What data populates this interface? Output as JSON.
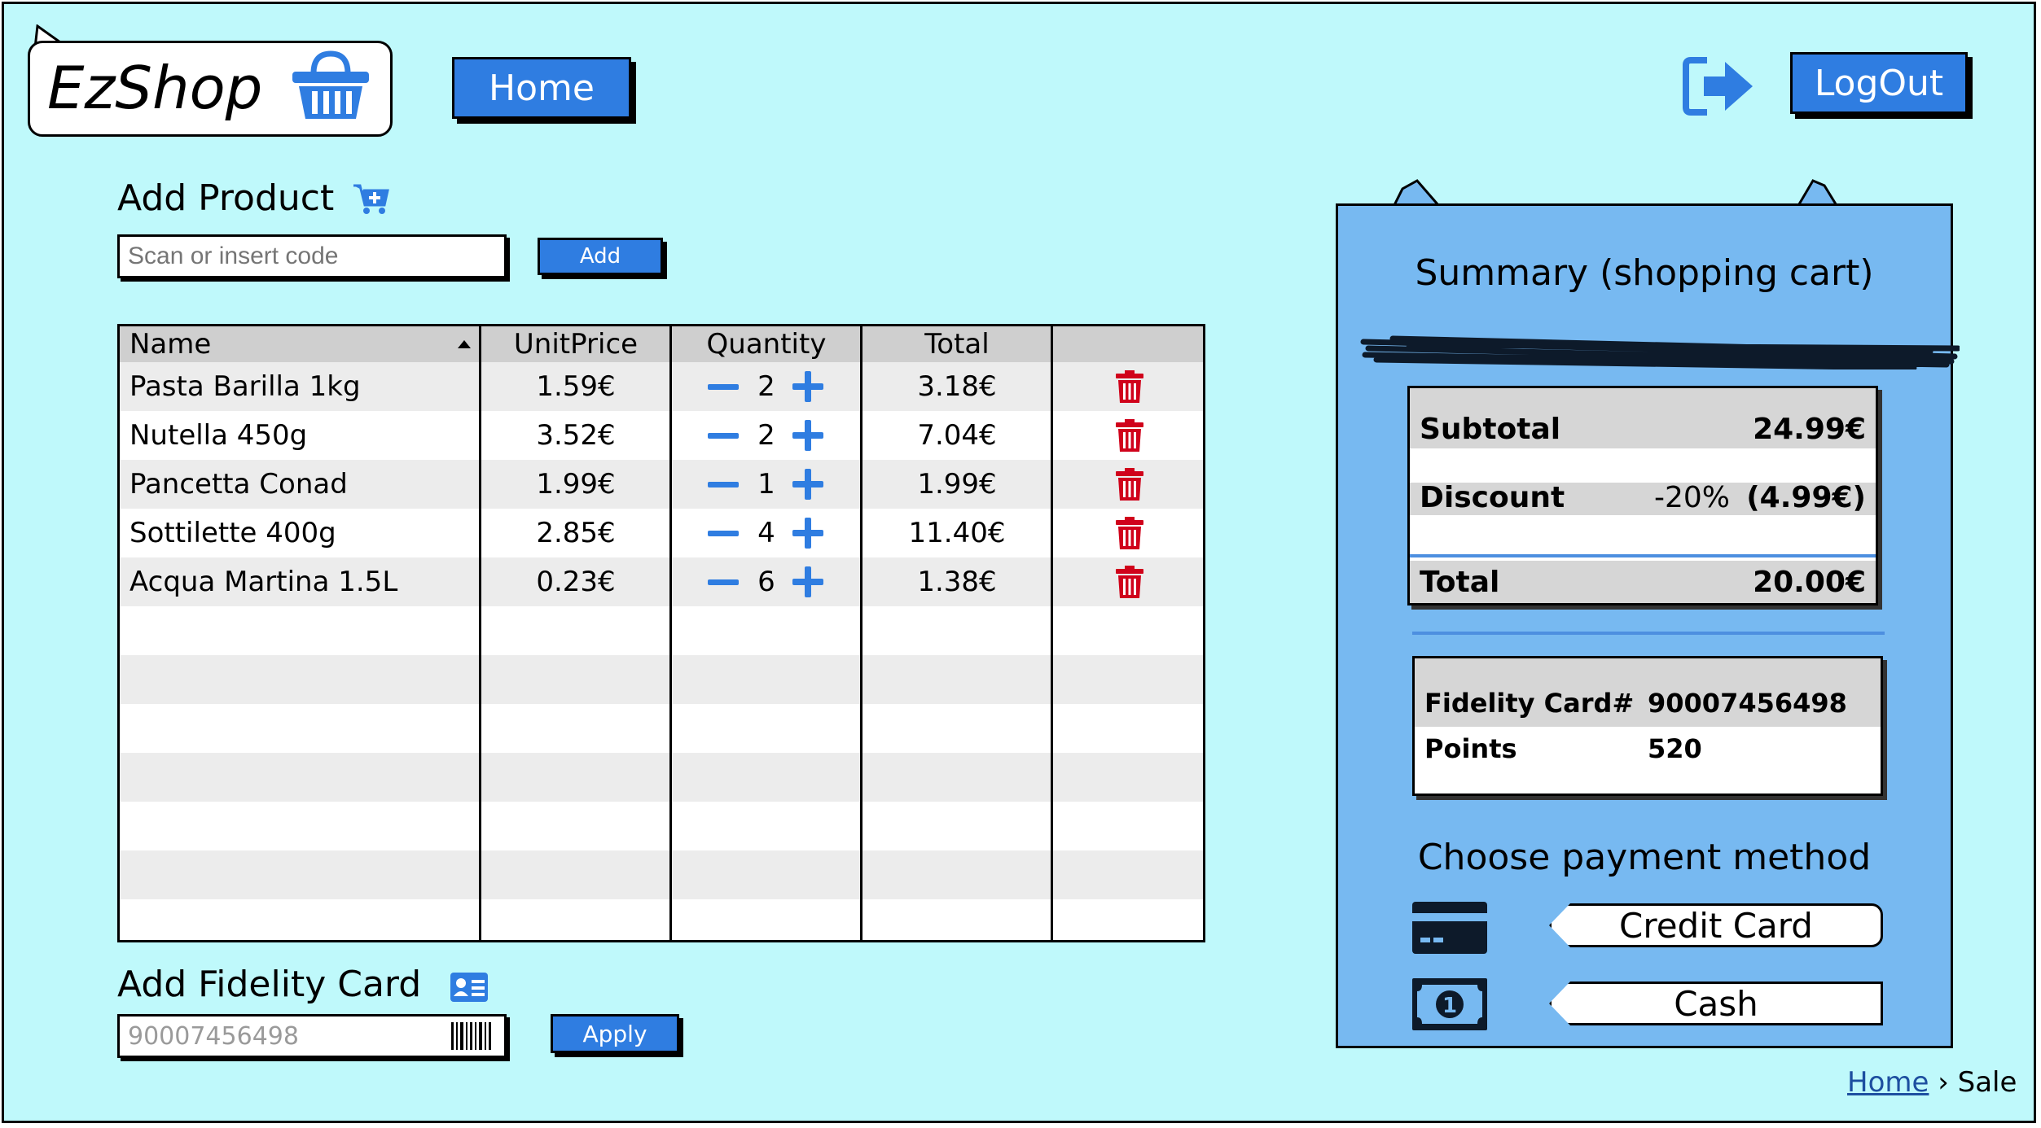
{
  "app": {
    "title": "EzShop"
  },
  "header": {
    "home_label": "Home",
    "logout_label": "LogOut"
  },
  "add_product": {
    "title": "Add Product",
    "placeholder": "Scan or insert code",
    "add_label": "Add"
  },
  "table": {
    "columns": [
      "Name",
      "UnitPrice",
      "Quantity",
      "Total"
    ],
    "rows": [
      {
        "name": "Pasta Barilla 1kg",
        "unit_price": "1.59€",
        "quantity": "2",
        "total": "3.18€"
      },
      {
        "name": "Nutella 450g",
        "unit_price": "3.52€",
        "quantity": "2",
        "total": "7.04€"
      },
      {
        "name": "Pancetta Conad",
        "unit_price": "1.99€",
        "quantity": "1",
        "total": "1.99€"
      },
      {
        "name": "Sottilette 400g",
        "unit_price": "2.85€",
        "quantity": "4",
        "total": "11.40€"
      },
      {
        "name": "Acqua Martina 1.5L",
        "unit_price": "0.23€",
        "quantity": "6",
        "total": "1.38€"
      }
    ]
  },
  "fidelity": {
    "title": "Add Fidelity Card",
    "value": "90007456498",
    "apply_label": "Apply"
  },
  "summary": {
    "title": "Summary (shopping cart)",
    "subtotal_label": "Subtotal",
    "subtotal_value": "24.99€",
    "discount_label": "Discount",
    "discount_percent": "-20%",
    "discount_value": "(4.99€)",
    "total_label": "Total",
    "total_value": "20.00€",
    "card_label": "Fidelity Card#",
    "card_value": "90007456498",
    "points_label": "Points",
    "points_value": "520",
    "payment_title": "Choose payment method",
    "credit_label": "Credit Card",
    "cash_label": "Cash"
  },
  "breadcrumb": {
    "home": "Home",
    "separator": "›",
    "current": "Sale"
  },
  "colors": {
    "background": "#bff9fb",
    "accent": "#2f7de1",
    "panel": "#77b9f1",
    "delete": "#d0021b"
  }
}
